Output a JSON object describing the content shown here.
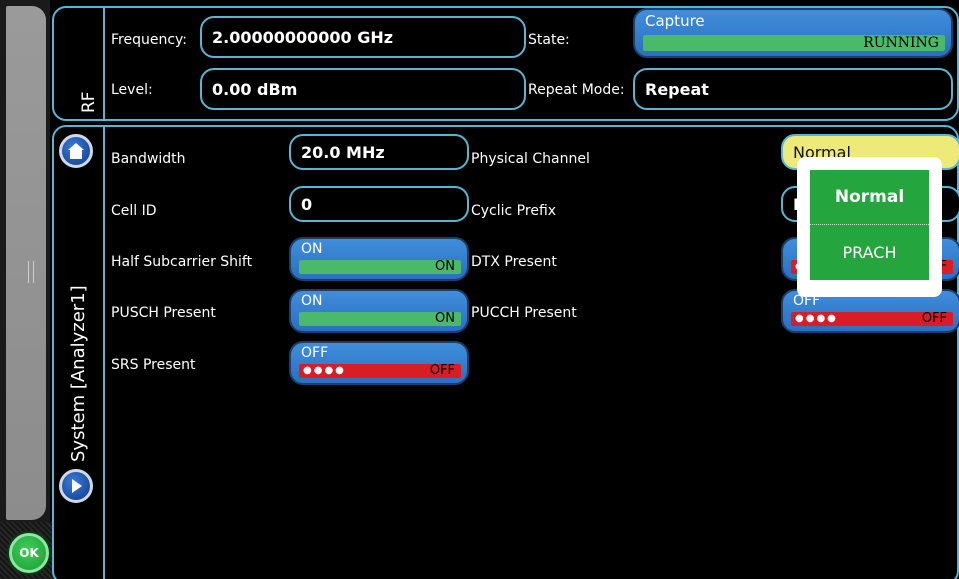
{
  "rail": {
    "ok_label": "OK"
  },
  "rf": {
    "tab_label": "RF",
    "frequency_label": "Frequency:",
    "frequency_value": "2.00000000000 GHz",
    "level_label": "Level:",
    "level_value": "0.00 dBm",
    "state_label": "State:",
    "state_value": "Capture",
    "state_status": "RUNNING",
    "repeat_label": "Repeat Mode:",
    "repeat_value": "Repeat"
  },
  "system": {
    "tab_label": "System [Analyzer1]",
    "bandwidth_label": "Bandwidth",
    "bandwidth_value": "20.0 MHz",
    "cell_id_label": "Cell ID",
    "cell_id_value": "0",
    "half_shift_label": "Half Subcarrier Shift",
    "half_shift_top": "ON",
    "half_shift_bar": "ON",
    "pusch_label": "PUSCH Present",
    "pusch_top": "ON",
    "pusch_bar": "ON",
    "srs_label": "SRS Present",
    "srs_top": "OFF",
    "srs_bar": "OFF",
    "physical_channel_label": "Physical Channel",
    "physical_channel_value": "Normal",
    "cyclic_prefix_label": "Cyclic Prefix",
    "cyclic_prefix_value": "N",
    "dtx_label": "DTX Present",
    "dtx_bar": "OFF",
    "pucch_label": "PUCCH Present",
    "pucch_top": "OFF",
    "pucch_bar": "OFF"
  },
  "dropdown": {
    "options": [
      "Normal",
      "PRACH"
    ]
  },
  "colors": {
    "accent": "#5ab4d2",
    "on": "#4ab96a",
    "off": "#d81e24",
    "button": "#2c6fbf",
    "ok": "#25a53e"
  }
}
